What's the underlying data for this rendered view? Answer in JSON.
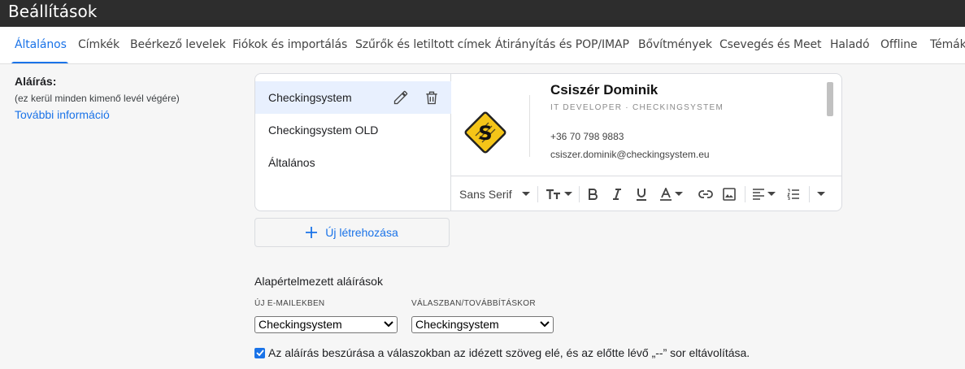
{
  "window": {
    "title": "Beállítások"
  },
  "tabs": [
    {
      "label": "Általános",
      "active": true
    },
    {
      "label": "Címkék"
    },
    {
      "label": "Beérkező levelek"
    },
    {
      "label": "Fiókok és importálás"
    },
    {
      "label": "Szűrők és letiltott címek"
    },
    {
      "label": "Átirányítás és POP/IMAP"
    },
    {
      "label": "Bővítmények"
    },
    {
      "label": "Csevegés és Meet"
    },
    {
      "label": "Haladó"
    },
    {
      "label": "Offline"
    },
    {
      "label": "Témák"
    }
  ],
  "signature_section": {
    "title": "Aláírás:",
    "subtitle": "(ez kerül minden kimenő levél végére)",
    "link": "További információ"
  },
  "signatures": [
    {
      "name": "Checkingsystem",
      "selected": true
    },
    {
      "name": "Checkingsystem OLD"
    },
    {
      "name": "Általános"
    }
  ],
  "preview": {
    "name": "Csiszér Dominik",
    "role": "IT DEVELOPER  ·  CHECKINGSYSTEM",
    "phone": "+36 70 798 9883",
    "email": "csiszer.dominik@checkingsystem.eu",
    "logo_letter": "S"
  },
  "toolbar": {
    "font": "Sans Serif"
  },
  "new_button": {
    "label": "Új létrehozása"
  },
  "defaults": {
    "title": "Alapértelmezett aláírások",
    "new_mail_label": "ÚJ E-MAILEKBEN",
    "new_mail_value": "Checkingsystem",
    "reply_label": "VÁLASZBAN/TOVÁBBÍTÁSKOR",
    "reply_value": "Checkingsystem"
  },
  "insert_option": {
    "checked": true,
    "label": "Az aláírás beszúrása a válaszokban az idézett szöveg elé, és az előtte lévő „--” sor eltávolítása."
  },
  "colors": {
    "accent": "#1a73e8",
    "selected_bg": "#e8f0fe",
    "titlebar": "#2d2d2d",
    "logo_yellow": "#f5c518"
  }
}
